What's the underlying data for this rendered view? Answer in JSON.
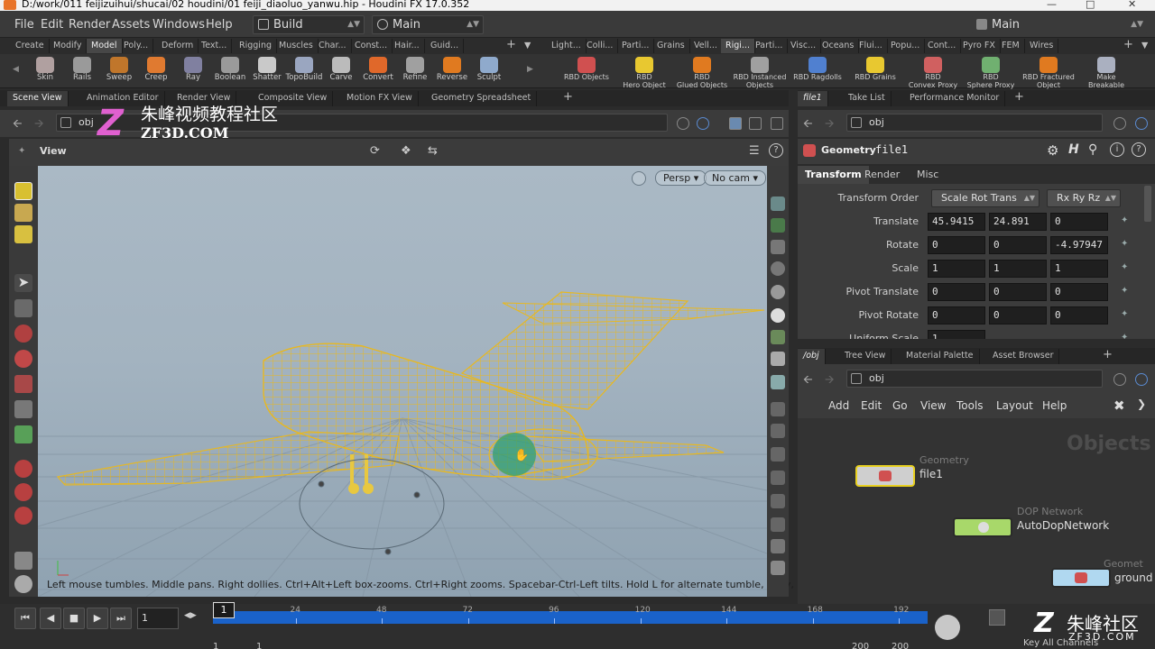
{
  "window": {
    "title": "D:/work/011 feijizuihui/shucai/02 houdini/01 feiji_diaoluo_yanwu.hip - Houdini FX 17.0.352"
  },
  "menubar": {
    "items": [
      "File",
      "Edit",
      "Render",
      "Assets",
      "Windows",
      "Help"
    ],
    "desk": "Build",
    "network": "Main",
    "right_desk": "Main"
  },
  "shelf": {
    "left_tabs": [
      "Create",
      "Modify",
      "Model",
      "Poly...",
      "Deform",
      "Text...",
      "Rigging",
      "Muscles",
      "Char...",
      "Const...",
      "Hair...",
      "Guid..."
    ],
    "active_left": "Model",
    "left_tools": [
      {
        "label": "Skin",
        "color": "#b0a0a0"
      },
      {
        "label": "Rails",
        "color": "#9a9a9a"
      },
      {
        "label": "Sweep",
        "color": "#c0762b"
      },
      {
        "label": "Creep",
        "color": "#e07a30"
      },
      {
        "label": "Ray",
        "color": "#8080a0"
      },
      {
        "label": "Boolean",
        "color": "#9a9a9a"
      },
      {
        "label": "Shatter",
        "color": "#c9c9c9"
      },
      {
        "label": "TopoBuild",
        "color": "#9aa6c0"
      },
      {
        "label": "Carve",
        "color": "#bbbbbb"
      },
      {
        "label": "Convert",
        "color": "#e0682a"
      },
      {
        "label": "Refine",
        "color": "#a0a0a0"
      },
      {
        "label": "Reverse",
        "color": "#e07a20"
      },
      {
        "label": "Sculpt",
        "color": "#8faacc"
      }
    ],
    "right_tabs": [
      "Light...",
      "Colli...",
      "Parti...",
      "Grains",
      "Vell...",
      "Rigi...",
      "Parti...",
      "Visc...",
      "Oceans",
      "Flui...",
      "Popu...",
      "Cont...",
      "Pyro FX",
      "FEM",
      "Wires"
    ],
    "active_right": "Rigi...",
    "right_tools": [
      {
        "label": "RBD Objects",
        "color": "#d05050"
      },
      {
        "label": "RBD\nHero Object",
        "color": "#e8c830"
      },
      {
        "label": "RBD\nGlued Objects",
        "color": "#e07a20"
      },
      {
        "label": "RBD Instanced\nObjects",
        "color": "#a0a0a0"
      },
      {
        "label": "RBD Ragdolls",
        "color": "#5080d0"
      },
      {
        "label": "RBD Grains",
        "color": "#e8c830"
      },
      {
        "label": "RBD\nConvex Proxy",
        "color": "#d06060"
      },
      {
        "label": "RBD\nSphere Proxy",
        "color": "#70b070"
      },
      {
        "label": "RBD Fractured\nObject",
        "color": "#e07a20"
      },
      {
        "label": "Make\nBreakable",
        "color": "#aab0c0"
      }
    ]
  },
  "viewer": {
    "tabs": [
      "Scene View",
      "Animation Editor",
      "Render View",
      "Composite View",
      "Motion FX View",
      "Geometry Spreadsheet"
    ],
    "active_tab": "Scene View",
    "path": "obj",
    "view_label": "View",
    "persp": "Persp",
    "cam": "No cam",
    "hint": "Left mouse tumbles. Middle pans. Right dollies. Ctrl+Alt+Left box-zooms. Ctrl+Right zooms. Spacebar-Ctrl-Left tilts. Hold L for alternate tumble, dolly, and zoom."
  },
  "watermark": {
    "site_cn": "朱峰视频教程社区",
    "site_url": "ZF3D.COM",
    "corner_cn": "朱峰社区",
    "corner_url": "ZF3D.COM"
  },
  "params": {
    "tabs": [
      "file1",
      "Take List",
      "Performance Monitor"
    ],
    "path": "obj",
    "node_type": "Geometry",
    "node_name": "file1",
    "section_tabs": [
      "Transform",
      "Render",
      "Misc"
    ],
    "active_section": "Transform",
    "transform_order_label": "Transform Order",
    "transform_order": "Scale Rot Trans",
    "rot_order": "Rx Ry Rz",
    "rows": [
      {
        "label": "Translate",
        "values": [
          "45.9415",
          "24.891",
          "0"
        ]
      },
      {
        "label": "Rotate",
        "values": [
          "0",
          "0",
          "-4.97947"
        ]
      },
      {
        "label": "Scale",
        "values": [
          "1",
          "1",
          "1"
        ]
      },
      {
        "label": "Pivot Translate",
        "values": [
          "0",
          "0",
          "0"
        ]
      },
      {
        "label": "Pivot Rotate",
        "values": [
          "0",
          "0",
          "0"
        ]
      },
      {
        "label": "Uniform Scale",
        "values": [
          "1"
        ]
      }
    ]
  },
  "network": {
    "tabs": [
      "/obj",
      "Tree View",
      "Material Palette",
      "Asset Browser"
    ],
    "path": "obj",
    "menu": [
      "Add",
      "Edit",
      "Go",
      "View",
      "Tools",
      "Layout",
      "Help"
    ],
    "context_label": "Objects",
    "nodes": [
      {
        "type": "Geometry",
        "name": "file1"
      },
      {
        "type": "DOP Network",
        "name": "AutoDopNetwork"
      },
      {
        "type": "Geomet",
        "name": "ground"
      }
    ]
  },
  "timeline": {
    "current_frame": "1",
    "frame_marker": "1",
    "ticks": [
      "24",
      "48",
      "72",
      "96",
      "120",
      "144",
      "168",
      "192"
    ],
    "start": "1",
    "start2": "1",
    "end": "200",
    "end2": "200",
    "key_label": "Key All Channels"
  }
}
